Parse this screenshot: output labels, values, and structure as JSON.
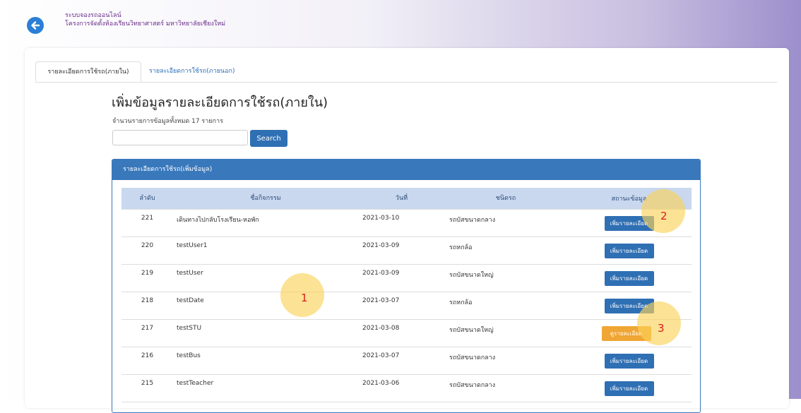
{
  "header": {
    "brand_line1": "ระบบจองรถออนไลน์",
    "brand_line2": "โครงการจัดตั้งห้องเรียนวิทยาศาสตร์ มหาวิทยาลัยเชียงใหม่"
  },
  "tabs": [
    {
      "label": "รายละเอียดการใช้รถ(ภายใน)",
      "active": true
    },
    {
      "label": "รายละเอียดการใช้รถ(ภายนอก)",
      "active": false
    }
  ],
  "main": {
    "title": "เพิ่มข้อมูลรายละเอียดการใช้รถ(ภายใน)",
    "count_text": "จำนวนรายการข้อมูลทั้งหมด 17 รายการ",
    "search_placeholder": "",
    "search_label": "Search"
  },
  "panel": {
    "heading": "รายละเอียดการใช้รถ(เพิ่มข้อมูล)"
  },
  "table": {
    "headers": [
      "ลำดับ",
      "ชื่อกิจกรรม",
      "วันที่",
      "ชนิดรถ",
      "สถานะข้อมูล"
    ],
    "rows": [
      {
        "num": "221",
        "name": "เดินทางไปกลับโรงเรียน-หอพัก",
        "date": "2021-03-10",
        "type": "รถบัสขนาดกลาง",
        "action": "เพิ่มรายละเอียด",
        "action_kind": "add"
      },
      {
        "num": "220",
        "name": "testUser1",
        "date": "2021-03-09",
        "type": "รถหกล้อ",
        "action": "เพิ่มรายละเอียด",
        "action_kind": "add"
      },
      {
        "num": "219",
        "name": "testUser",
        "date": "2021-03-09",
        "type": "รถบัสขนาดใหญ่",
        "action": "เพิ่มรายละเอียด",
        "action_kind": "add"
      },
      {
        "num": "218",
        "name": "testDate",
        "date": "2021-03-07",
        "type": "รถหกล้อ",
        "action": "เพิ่มรายละเอียด",
        "action_kind": "add"
      },
      {
        "num": "217",
        "name": "testSTU",
        "date": "2021-03-08",
        "type": "รถบัสขนาดใหญ่",
        "action": "ดูรายละเอียด",
        "action_kind": "view"
      },
      {
        "num": "216",
        "name": "testBus",
        "date": "2021-03-07",
        "type": "รถบัสขนาดกลาง",
        "action": "เพิ่มรายละเอียด",
        "action_kind": "add"
      },
      {
        "num": "215",
        "name": "testTeacher",
        "date": "2021-03-06",
        "type": "รถบัสขนาดกลาง",
        "action": "เพิ่มรายละเอียด",
        "action_kind": "add"
      }
    ]
  },
  "annotations": {
    "marker_1": "1",
    "marker_2": "2",
    "marker_3": "3"
  },
  "colors": {
    "primary": "#2f6fb4",
    "header_bg": "#c9d8ef",
    "view_button": "#f0a634",
    "marker": "#f9d35a",
    "marker_text": "#d81b1b"
  },
  "icons": {
    "back": "arrow-left-circle-icon"
  }
}
